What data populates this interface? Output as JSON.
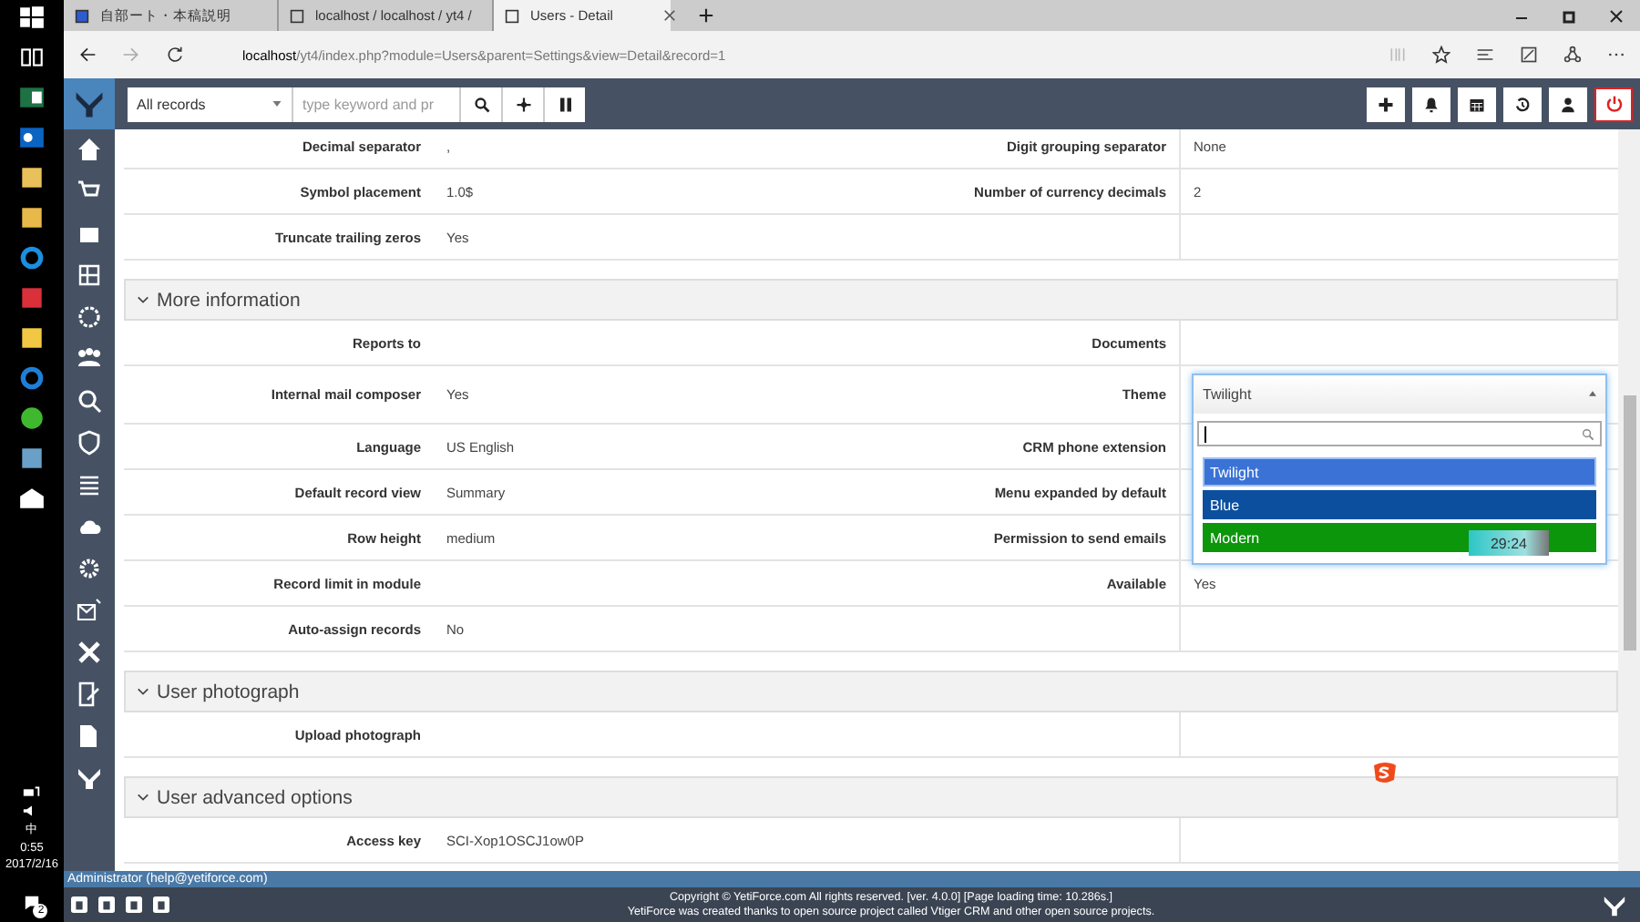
{
  "taskbar": {
    "ime": "中",
    "time": "0:55",
    "date": "2017/2/16",
    "notifications": "2"
  },
  "browser": {
    "tabs": [
      {
        "title": "自部ート・本稿説明",
        "selected": false
      },
      {
        "title": "localhost / localhost / yt4 /",
        "selected": false
      },
      {
        "title": "Users - Detail",
        "selected": true
      }
    ],
    "url_host": "localhost",
    "url_path": "/yt4/index.php?module=Users&parent=Settings&view=Detail&record=1"
  },
  "header": {
    "filter": "All records",
    "search": {
      "placeholder": "type keyword and pr"
    }
  },
  "blocks": [
    {
      "rows": [
        {
          "cells": [
            {
              "label": "Decimal separator",
              "value": ","
            },
            {
              "label": "Digit grouping separator",
              "value": "None"
            }
          ]
        },
        {
          "cells": [
            {
              "label": "Symbol placement",
              "value": "1.0$"
            },
            {
              "label": "Number of currency decimals",
              "value": "2"
            }
          ]
        },
        {
          "cells": [
            {
              "label": "Truncate trailing zeros",
              "value": "Yes"
            }
          ]
        }
      ]
    },
    {
      "title": "More information",
      "rows": [
        {
          "cells": [
            {
              "label": "Reports to"
            },
            {
              "label": "Documents"
            }
          ]
        },
        {
          "cells": [
            {
              "label": "Internal mail composer",
              "value": "Yes"
            },
            {
              "label": "Theme"
            }
          ]
        },
        {
          "cells": [
            {
              "label": "Language",
              "value": "US English"
            },
            {
              "label": "CRM phone extension"
            }
          ]
        },
        {
          "cells": [
            {
              "label": "Default record view",
              "value": "Summary"
            },
            {
              "label": "Menu expanded by default"
            }
          ]
        },
        {
          "cells": [
            {
              "label": "Row height",
              "value": "medium"
            },
            {
              "label": "Permission to send emails"
            }
          ]
        },
        {
          "cells": [
            {
              "label": "Record limit in module"
            },
            {
              "label": "Available",
              "value": "Yes"
            }
          ]
        },
        {
          "cells": [
            {
              "label": "Auto-assign records",
              "value": "No"
            }
          ]
        }
      ]
    },
    {
      "title": "User photograph",
      "rows": [
        {
          "cells": [
            {
              "label": "Upload photograph"
            }
          ]
        }
      ]
    },
    {
      "title": "User advanced options",
      "rows": [
        {
          "cells": [
            {
              "label": "Access key",
              "value": "SCI-Xop1OSCJ1ow0P"
            }
          ]
        }
      ]
    }
  ],
  "theme_dropdown": {
    "value": "Twilight",
    "options": [
      {
        "label": "Twilight",
        "color": "#3a72d6",
        "selected": true
      },
      {
        "label": "Blue",
        "color": "#0b4f9e",
        "selected": false
      },
      {
        "label": "Modern",
        "color": "#0b960b",
        "selected": false
      }
    ]
  },
  "floating_timer": "29:24",
  "footer": {
    "user": "Administrator (help@yetiforce.com)",
    "copyright": "Copyright © YetiForce.com All rights reserved. [ver. 4.0.0] [Page loading time: 10.286s.]",
    "credits": "YetiForce was created thanks to open source project called Vtiger CRM and other open source projects."
  }
}
